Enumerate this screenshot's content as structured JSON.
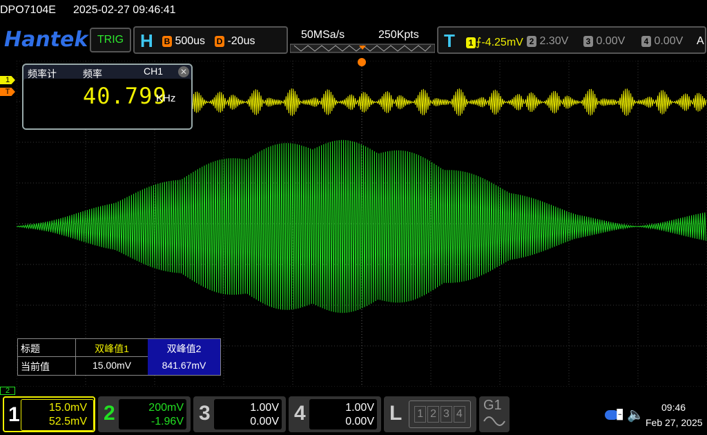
{
  "status_bar": {
    "model": "DPO7104E",
    "datetime": "2025-02-27 09:46:41"
  },
  "header": {
    "brand": "Hantek",
    "trig_label": "TRIG",
    "horizontal": {
      "letter": "H",
      "b_tag": "B",
      "timebase": "500us",
      "d_tag": "D",
      "delay": "-20us"
    },
    "acquisition": {
      "sample_rate": "50MSa/s",
      "record_length": "250Kpts"
    },
    "trigger": {
      "letter": "T",
      "ch1_tag": "1",
      "ch1_level": "-4.25mV",
      "ch2_tag": "2",
      "ch2_level": "2.30V",
      "ch3_tag": "3",
      "ch3_level": "0.00V",
      "ch4_tag": "4",
      "ch4_level": "0.00V",
      "mode": "A"
    }
  },
  "markers": {
    "ch1": "1",
    "trig": "T",
    "ch2": "2"
  },
  "freq_counter": {
    "title": "频率计",
    "label": "频率",
    "channel": "CH1",
    "value": "40.799",
    "unit": "KHz"
  },
  "measurement_table": {
    "row_header_1": "标题",
    "col1": "双峰值1",
    "col2": "双峰值2",
    "row_header_2": "当前值",
    "val1": "15.00mV",
    "val2": "841.67mV"
  },
  "channels": [
    {
      "num": "1",
      "scale": "15.0mV",
      "offset": "52.5mV",
      "color": "#f0f000"
    },
    {
      "num": "2",
      "scale": "200mV",
      "offset": "-1.96V",
      "color": "#22e022"
    },
    {
      "num": "3",
      "scale": "1.00V",
      "offset": "0.00V",
      "color": "#aaaaaa"
    },
    {
      "num": "4",
      "scale": "1.00V",
      "offset": "0.00V",
      "color": "#aaaaaa"
    }
  ],
  "logic": {
    "letter": "L",
    "bits": [
      "1",
      "2",
      "3",
      "4"
    ]
  },
  "gen": {
    "label": "G1"
  },
  "clock": {
    "time": "09:46",
    "date": "Feb 27, 2025"
  },
  "colors": {
    "ch1": "#f0f000",
    "ch2": "#22e022",
    "trigger_marker": "#ff7a00",
    "accent": "#2f6fe8"
  }
}
